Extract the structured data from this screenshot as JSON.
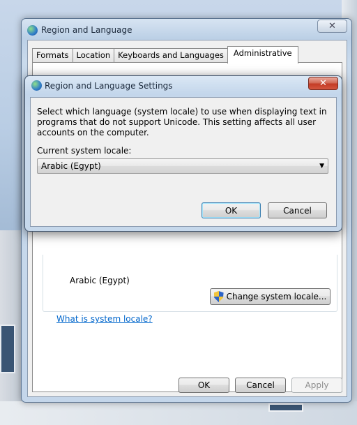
{
  "main_window": {
    "title": "Region and Language",
    "tabs": [
      {
        "label": "Formats"
      },
      {
        "label": "Location"
      },
      {
        "label": "Keyboards and Languages"
      },
      {
        "label": "Administrative"
      }
    ],
    "current_locale_value": "Arabic (Egypt)",
    "change_locale_button": "Change system locale...",
    "what_is_locale_link": "What is system locale?",
    "ok_button": "OK",
    "cancel_button": "Cancel",
    "apply_button": "Apply"
  },
  "dialog": {
    "title": "Region and Language Settings",
    "description": "Select which language (system locale) to use when displaying text in programs that do not support Unicode. This setting affects all user accounts on the computer.",
    "locale_label": "Current system locale:",
    "selected_locale": "Arabic (Egypt)",
    "ok_button": "OK",
    "cancel_button": "Cancel"
  }
}
